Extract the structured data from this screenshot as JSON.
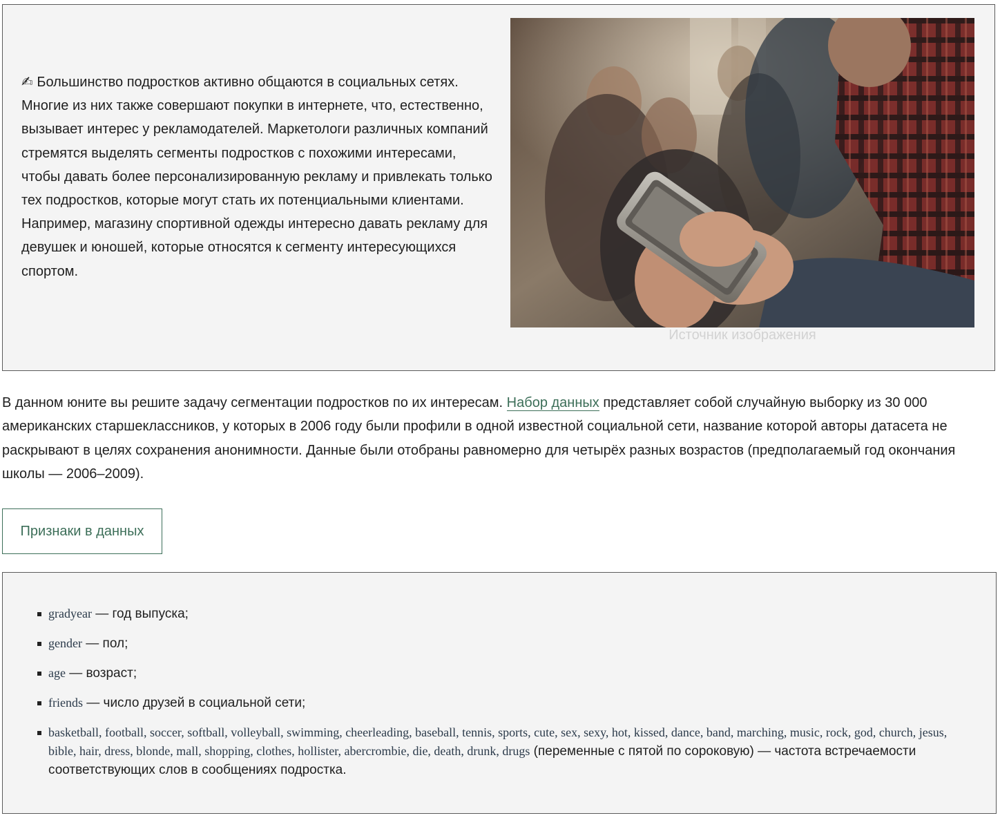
{
  "intro": {
    "icon": "writing-hand-icon",
    "icon_glyph": "✍",
    "text": "Большинство подростков активно общаются в социальных сетях. Многие из них также совершают покупки в интернете, что, естественно, вызывает интерес у рекламодателей. Маркетологи различных компаний стремятся выделять сегменты подростков с похожими интересами, чтобы давать более персонализированную рекламу и привлекать только тех подростков, которые могут стать их потенциальными клиентами. Например, магазину спортивной одежды интересно давать рекламу для девушек и юношей, которые относятся к сегменту интересующихся спортом.",
    "image_caption": "Источник изображения"
  },
  "paragraph": {
    "before_link": "В данном юните вы решите задачу сегментации подростков по их интересам. ",
    "link_text": "Набор данных",
    "after_link": " представляет собой случайную выборку из 30 000 американских старшеклассников, у которых в 2006 году были профили в одной известной социальной сети, название которой авторы датасета не раскрывают в целях сохранения анонимности. Данные были отобраны равномерно для четырёх разных возрастов (предполагаемый год окончания школы — 2006–2009)."
  },
  "features_button": "Признаки в данных",
  "features": [
    {
      "code": "gradyear",
      "desc": " — год выпуска;"
    },
    {
      "code": "gender",
      "desc": " — пол;"
    },
    {
      "code": "age",
      "desc": " — возраст;"
    },
    {
      "code": "friends",
      "desc": " — число друзей в социальной сети;"
    },
    {
      "code": "basketball, football, soccer, softball, volleyball, swimming, cheerleading, baseball, tennis, sports, cute, sex, sexy, hot, kissed, dance, band, marching, music, rock, god, church, jesus, bible, hair, dress, blonde, mall, shopping, clothes, hollister, abercrombie, die, death, drunk, drugs",
      "desc": " (переменные с пятой по сороковую) — частота встречаемости соответствующих слов в сообщениях подростка."
    }
  ],
  "colors": {
    "accent": "#3c6e58",
    "box_background": "#f4f4f4",
    "caption": "#d2d2d2"
  }
}
